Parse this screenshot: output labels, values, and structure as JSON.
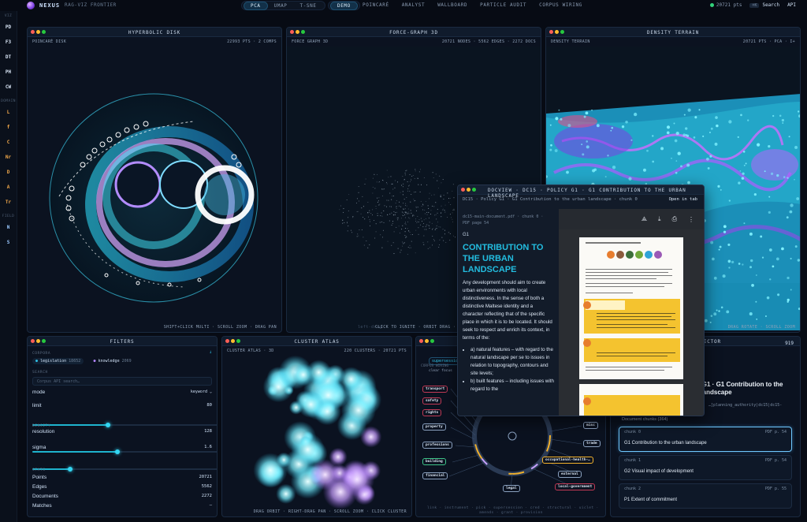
{
  "brand": {
    "name": "NEXUS",
    "subtitle": "RAG-VIZ FRONTIER"
  },
  "projection": {
    "options": [
      "PCA",
      "UMAP",
      "T-SNE"
    ],
    "selected": "PCA"
  },
  "mode": {
    "options": [
      "DEMO",
      "POINCARÉ",
      "ANALYST",
      "WALLBOARD",
      "PARTICLE AUDIT",
      "CORPUS WIRING"
    ],
    "selected": "DEMO"
  },
  "status": {
    "points": "20721 pts",
    "search_label": "Search",
    "search_kbd": "⌘K",
    "api_label": "API"
  },
  "rail": {
    "top_section": "VIZ",
    "views": [
      "PD",
      "F3",
      "DT",
      "PH",
      "CW"
    ],
    "domain_section": "DOMAIN",
    "domains": [
      "L",
      "f",
      "C",
      "Nr",
      "D",
      "A",
      "Tr"
    ],
    "field_section": "FIELD",
    "fields": [
      "N",
      "S"
    ]
  },
  "panels": {
    "hyperbolic": {
      "title": "HYPERBOLIC DISK",
      "label": "POINCARÉ DISK",
      "stats": "22993 PTS · 2 COMPS",
      "hint": "SHIFT+CLICK MULTI · SCROLL ZOOM · DRAG PAN"
    },
    "force": {
      "title": "FORCE-GRAPH 3D",
      "label": "FORCE GRAPH 3D",
      "stats": "20721 NODES · 5562 EDGES · 2272 DOCS",
      "hint": "CLICK TO IGNITE · ORBIT DRAG · SCROLL",
      "hint_faint": "left-drag"
    },
    "terrain": {
      "title": "DENSITY TERRAIN",
      "label": "DENSITY TERRAIN",
      "stats": "20721 PTS · PCA · I+",
      "hint": "DRAG ROTATE · SCROLL ZOOM"
    },
    "filters": {
      "title": "FILTERS",
      "corpora_label": "CORPORA",
      "corpora": [
        {
          "name": "legislation",
          "count": "18652",
          "color": "#2fc3e8"
        },
        {
          "name": "knowledge",
          "count": "2069",
          "color": "#b586ff"
        }
      ],
      "search_label": "SEARCH",
      "search_placeholder": "Corpus API search…",
      "mode_label": "mode",
      "mode_value": "keyword",
      "limit_label": "limit",
      "limit_value": "80",
      "limit_fraction": 0.4,
      "density_label": "DENSITY",
      "resolution_label": "resolution",
      "resolution_value": "128",
      "resolution_fraction": 0.45,
      "sigma_label": "sigma",
      "sigma_value": "1.6",
      "sigma_fraction": 0.2,
      "stats_label": "STATS",
      "stats": [
        {
          "k": "Points",
          "v": "20721"
        },
        {
          "k": "Edges",
          "v": "5562"
        },
        {
          "k": "Documents",
          "v": "2272"
        },
        {
          "k": "Matches",
          "v": "—"
        }
      ]
    },
    "atlas": {
      "title": "CLUSTER ATLAS",
      "label": "CLUSTER ATLAS · 3D",
      "stats": "220 CLUSTERS · 20721 PTS",
      "hint": "DRAG ORBIT · RIGHT-DRAG PAN · SCROLL ZOOM · CLICK CLUSTER"
    },
    "wiring": {
      "chip": "supersession",
      "label": "CORPUS WIRING",
      "sub": "clear focus",
      "nodes": [
        "transport",
        "safety",
        "rights",
        "property",
        "professions",
        "building",
        "financial",
        "misc",
        "trade",
        "occupational-health-…",
        "external",
        "local-government",
        "legal"
      ],
      "legend_1": "link · instrument · pick · supersession · cred · structural · uiclet ·",
      "legend_2": "amends · grant · provision"
    },
    "inspector": {
      "title": "INSPECTOR",
      "count": "919",
      "heading": "Policy G1 · G1 Contribution to the urban landscape",
      "path": "…]planning_authority|dc15|dc15-",
      "chunks_label": "Document chunks (364)",
      "chunks": [
        {
          "id": "chunk 0",
          "page": "PDF p. 54",
          "text": "G1 Contribution to the urban landscape"
        },
        {
          "id": "chunk 1",
          "page": "PDF p. 54",
          "text": "G2 Visual impact of development"
        },
        {
          "id": "chunk 2",
          "page": "PDF p. 55",
          "text": "P1 Extent of commitment"
        }
      ]
    }
  },
  "docview": {
    "title": "DOCVIEW · DC15 · POLICY G1 · G1 CONTRIBUTION TO THE URBAN LANDSCAPE",
    "sub": "DC15 · Policy G1 · G1 Contribution to the urban landscape · chunk 0",
    "open_label": "Open in tab",
    "file": "dc15-main-document.pdf · chunk 0 ·",
    "page": "PDF page 54",
    "section": "G1",
    "heading": "CONTRIBUTION TO THE URBAN LANDSCAPE",
    "para": "Any development should aim to create urban environments with local distinctiveness. In the sense of both a distinctive Maltese identity and a character reflecting that of the specific place in which it is to be located. It should seek to respect and enrich its context, in terms of the:",
    "items": [
      "a) natural features – with regard to the natural landscape per se to issues in relation to topography, contours and site levels;",
      "b) built features – including issues with regard to the"
    ]
  }
}
